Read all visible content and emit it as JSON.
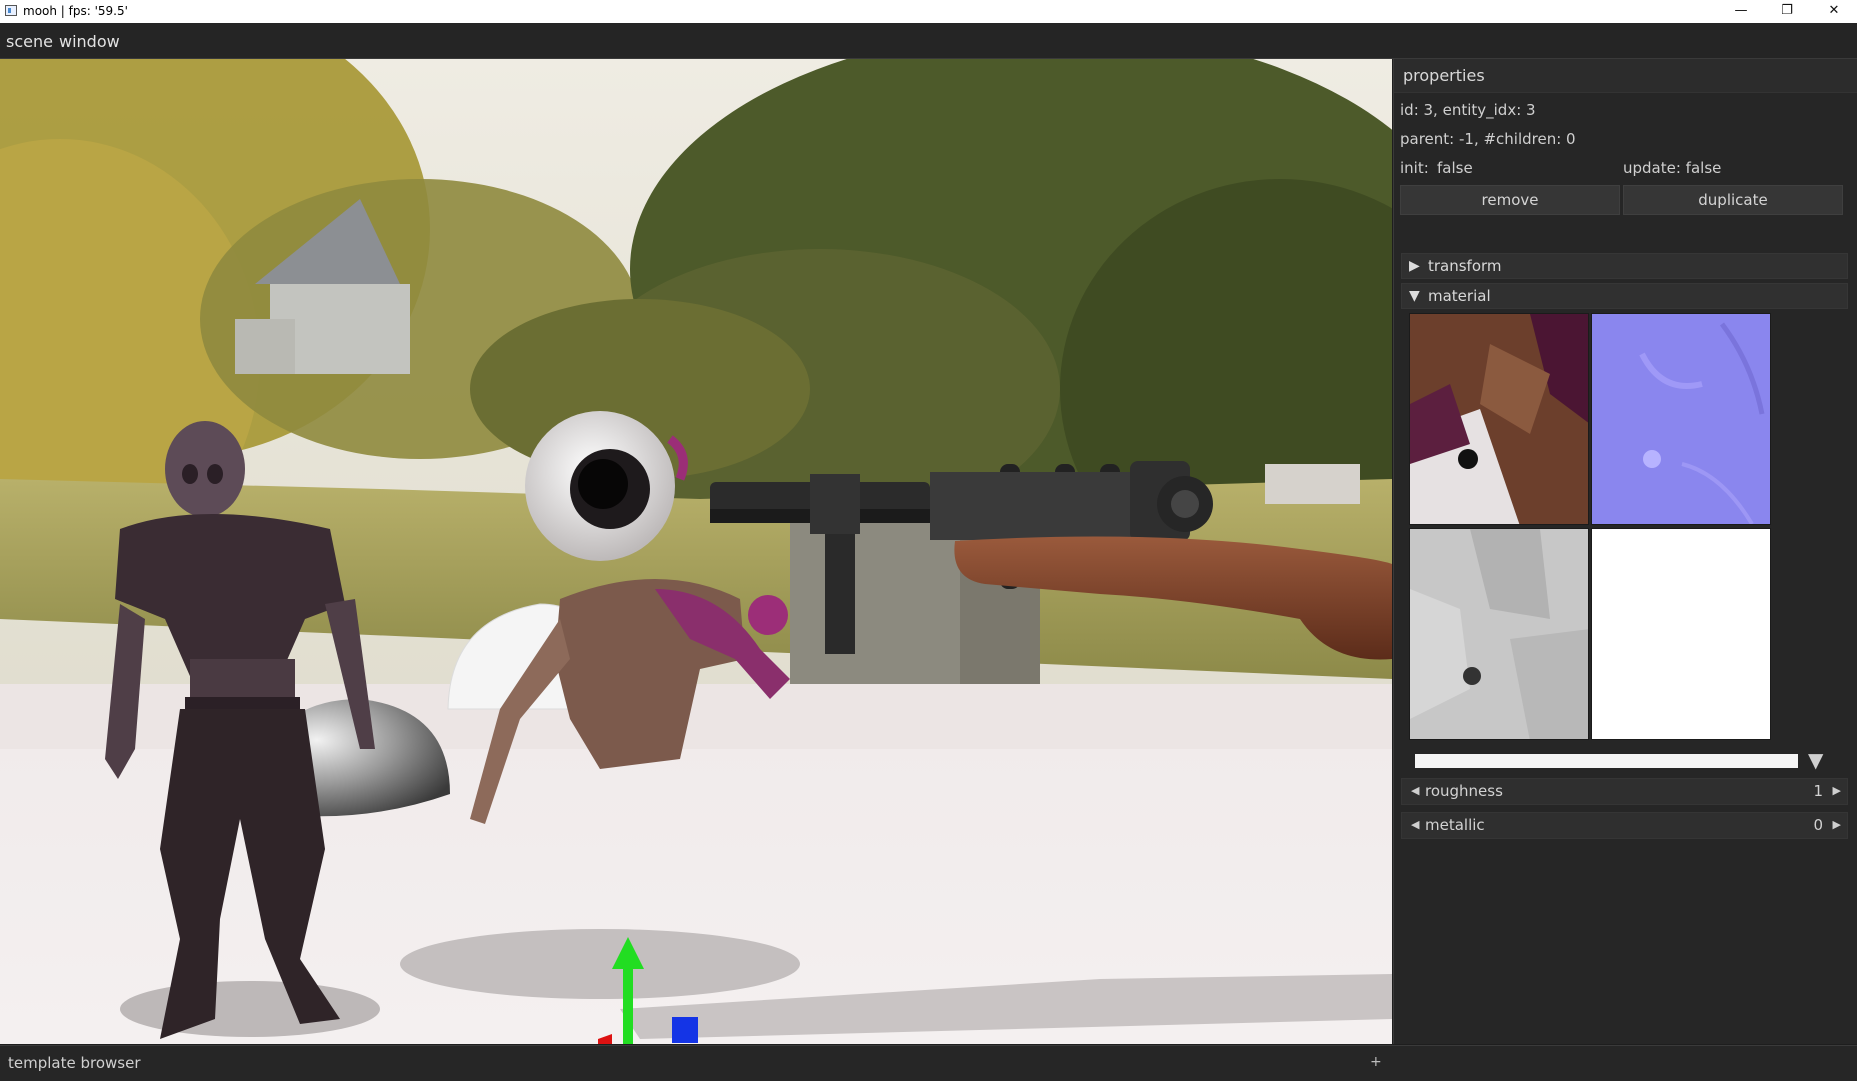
{
  "window": {
    "title": "mooh | fps: '59.5'",
    "minimize_glyph": "—",
    "maximize_glyph": "❐",
    "close_glyph": "✕"
  },
  "menu": {
    "items": [
      {
        "label": "scene"
      },
      {
        "label": "window"
      }
    ]
  },
  "viewport": {
    "gizmo": {
      "axes": [
        "x-red",
        "y-green",
        "z-blue"
      ]
    }
  },
  "properties": {
    "header": "properties",
    "entity_line": "id: 3, entity_idx: 3",
    "parent_line": "parent: -1, #children: 0",
    "init_label": "init:",
    "init_value": "false",
    "update_text": "update: false",
    "remove_label": "remove",
    "duplicate_label": "duplicate",
    "sections": {
      "transform": {
        "label": "transform",
        "arrow": "▶",
        "expanded": false
      },
      "material": {
        "label": "material",
        "arrow": "▼",
        "expanded": true
      }
    },
    "material": {
      "textures": [
        "albedo-map",
        "normal-map",
        "ambient-occlusion-map",
        "blank-white-map"
      ],
      "combo_arrow": "▼",
      "roughness": {
        "label": "roughness",
        "value": "1",
        "left_arrow": "◀",
        "right_arrow": "▶"
      },
      "metallic": {
        "label": "metallic",
        "value": "0",
        "left_arrow": "◀",
        "right_arrow": "▶"
      }
    }
  },
  "bottom": {
    "label": "template browser",
    "plus": "+"
  }
}
